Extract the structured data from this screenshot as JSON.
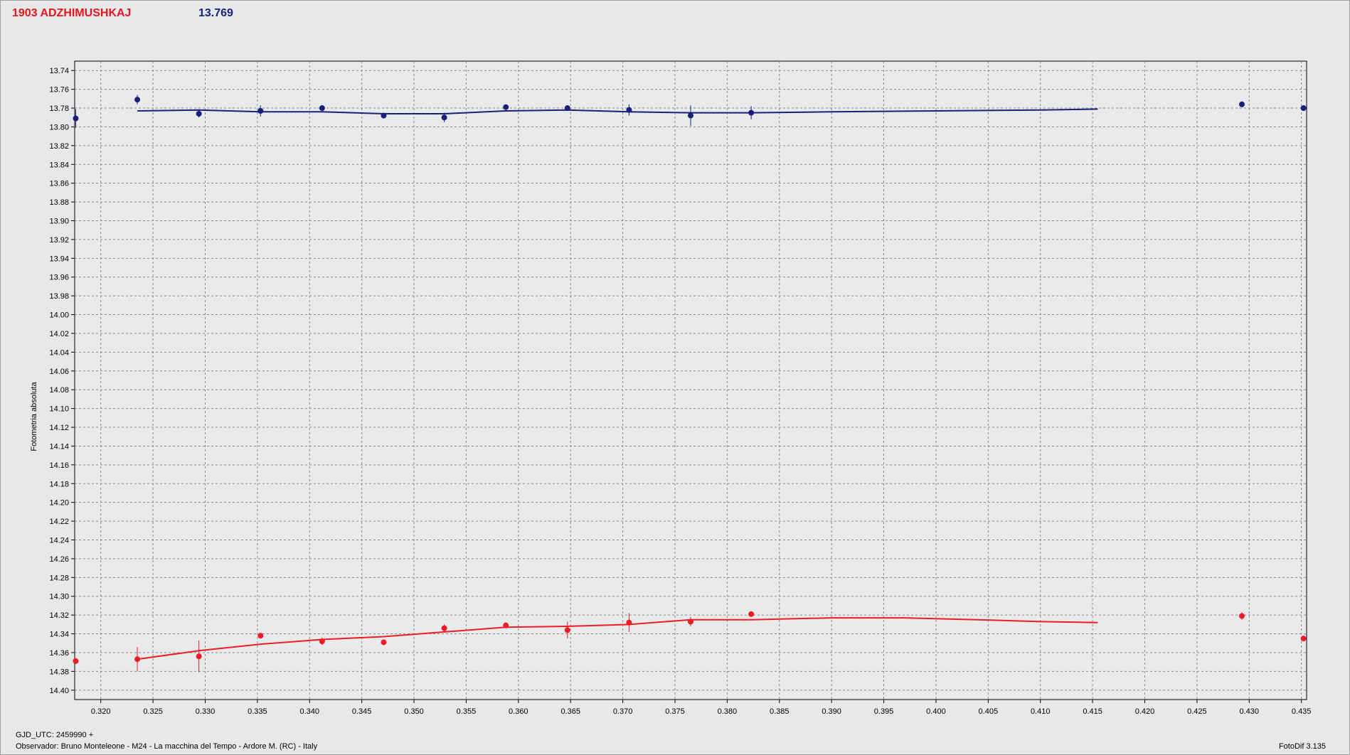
{
  "header": {
    "object_name": "1903 ADZHIMUSHKAJ",
    "magnitude": "13.769"
  },
  "footer": {
    "gjd": "GJD_UTC: 2459990 +",
    "observer": "Observador: Bruno Monteleone - M24 - La macchina del Tempo - Ardore M. (RC) - Italy",
    "software": "FotoDif 3.135"
  },
  "colors": {
    "background": "#e7e8e9",
    "plot_background": "#e9eaeb",
    "grid": "#8a8a8a",
    "series_blue": "#1a1f7a",
    "series_red": "#ee1c24"
  },
  "chart_data": {
    "type": "scatter",
    "title": "",
    "xlabel": "",
    "ylabel": "Fotometria absoluta",
    "xlim": [
      0.3175,
      0.4355
    ],
    "ylim": [
      13.73,
      14.41
    ],
    "y_inverted": true,
    "grid": true,
    "x_ticks": [
      0.32,
      0.325,
      0.33,
      0.335,
      0.34,
      0.345,
      0.35,
      0.355,
      0.36,
      0.365,
      0.37,
      0.375,
      0.38,
      0.385,
      0.39,
      0.395,
      0.4,
      0.405,
      0.41,
      0.415,
      0.42,
      0.425,
      0.43,
      0.435
    ],
    "x_tick_labels": [
      "0.320",
      "0.325",
      "0.330",
      "0.335",
      "0.340",
      "0.345",
      "0.350",
      "0.355",
      "0.360",
      "0.365",
      "0.370",
      "0.375",
      "0.380",
      "0.385",
      "0.390",
      "0.395",
      "0.400",
      "0.405",
      "0.410",
      "0.415",
      "0.420",
      "0.425",
      "0.430",
      "0.435"
    ],
    "y_ticks": [
      13.74,
      13.76,
      13.78,
      13.8,
      13.82,
      13.84,
      13.86,
      13.88,
      13.9,
      13.92,
      13.94,
      13.96,
      13.98,
      14.0,
      14.02,
      14.04,
      14.06,
      14.08,
      14.1,
      14.12,
      14.14,
      14.16,
      14.18,
      14.2,
      14.22,
      14.24,
      14.26,
      14.28,
      14.3,
      14.32,
      14.34,
      14.36,
      14.38,
      14.4
    ],
    "y_tick_labels": [
      "13.74",
      "13.76",
      "13.78",
      "13.80",
      "13.82",
      "13.84",
      "13.86",
      "13.88",
      "13.90",
      "13.92",
      "13.94",
      "13.96",
      "13.98",
      "14.00",
      "14.02",
      "14.04",
      "14.06",
      "14.08",
      "14.10",
      "14.12",
      "14.14",
      "14.16",
      "14.18",
      "14.20",
      "14.22",
      "14.24",
      "14.26",
      "14.28",
      "14.30",
      "14.32",
      "14.34",
      "14.36",
      "14.38",
      "14.40"
    ],
    "series": [
      {
        "color": "#1a1f7a",
        "points": [
          {
            "x": 0.3176,
            "y": 13.791,
            "err": 0.01
          },
          {
            "x": 0.3235,
            "y": 13.771,
            "err": 0.005
          },
          {
            "x": 0.3294,
            "y": 13.786,
            "err": 0.004
          },
          {
            "x": 0.3353,
            "y": 13.783,
            "err": 0.006
          },
          {
            "x": 0.3412,
            "y": 13.78,
            "err": 0.003
          },
          {
            "x": 0.3471,
            "y": 13.788,
            "err": 0.003
          },
          {
            "x": 0.3529,
            "y": 13.79,
            "err": 0.005
          },
          {
            "x": 0.3588,
            "y": 13.779,
            "err": 0.003
          },
          {
            "x": 0.3647,
            "y": 13.78,
            "err": 0.003
          },
          {
            "x": 0.3706,
            "y": 13.782,
            "err": 0.006
          },
          {
            "x": 0.3765,
            "y": 13.788,
            "err": 0.011
          },
          {
            "x": 0.3823,
            "y": 13.785,
            "err": 0.007
          },
          {
            "x": 0.4293,
            "y": 13.776,
            "err": 0.003
          },
          {
            "x": 0.4352,
            "y": 13.78,
            "err": 0.003
          }
        ],
        "fit": {
          "x": [
            0.3235,
            0.3294,
            0.3353,
            0.3412,
            0.3471,
            0.3529,
            0.3588,
            0.3647,
            0.3706,
            0.3765,
            0.3823,
            0.39,
            0.4,
            0.41,
            0.4155
          ],
          "y": [
            13.783,
            13.782,
            13.784,
            13.784,
            13.786,
            13.786,
            13.783,
            13.782,
            13.784,
            13.785,
            13.785,
            13.784,
            13.783,
            13.782,
            13.781
          ]
        }
      },
      {
        "color": "#ee1c24",
        "points": [
          {
            "x": 0.3176,
            "y": 14.369,
            "err": 0.003
          },
          {
            "x": 0.3235,
            "y": 14.367,
            "err": 0.013
          },
          {
            "x": 0.3294,
            "y": 14.364,
            "err": 0.017
          },
          {
            "x": 0.3353,
            "y": 14.342,
            "err": 0.003
          },
          {
            "x": 0.3412,
            "y": 14.348,
            "err": 0.004
          },
          {
            "x": 0.3471,
            "y": 14.349,
            "err": 0.003
          },
          {
            "x": 0.3529,
            "y": 14.334,
            "err": 0.004
          },
          {
            "x": 0.3588,
            "y": 14.331,
            "err": 0.003
          },
          {
            "x": 0.3647,
            "y": 14.336,
            "err": 0.009
          },
          {
            "x": 0.3706,
            "y": 14.328,
            "err": 0.01
          },
          {
            "x": 0.3765,
            "y": 14.327,
            "err": 0.005
          },
          {
            "x": 0.3823,
            "y": 14.319,
            "err": 0.003
          },
          {
            "x": 0.4293,
            "y": 14.321,
            "err": 0.004
          },
          {
            "x": 0.4352,
            "y": 14.345,
            "err": 0.002
          }
        ],
        "fit": {
          "x": [
            0.3235,
            0.3294,
            0.3353,
            0.3412,
            0.3471,
            0.3529,
            0.3588,
            0.3647,
            0.3706,
            0.3765,
            0.3823,
            0.39,
            0.397,
            0.404,
            0.41,
            0.4155
          ],
          "y": [
            14.367,
            14.358,
            14.351,
            14.346,
            14.343,
            14.338,
            14.333,
            14.332,
            14.33,
            14.325,
            14.325,
            14.323,
            14.323,
            14.325,
            14.327,
            14.328
          ]
        }
      }
    ]
  }
}
